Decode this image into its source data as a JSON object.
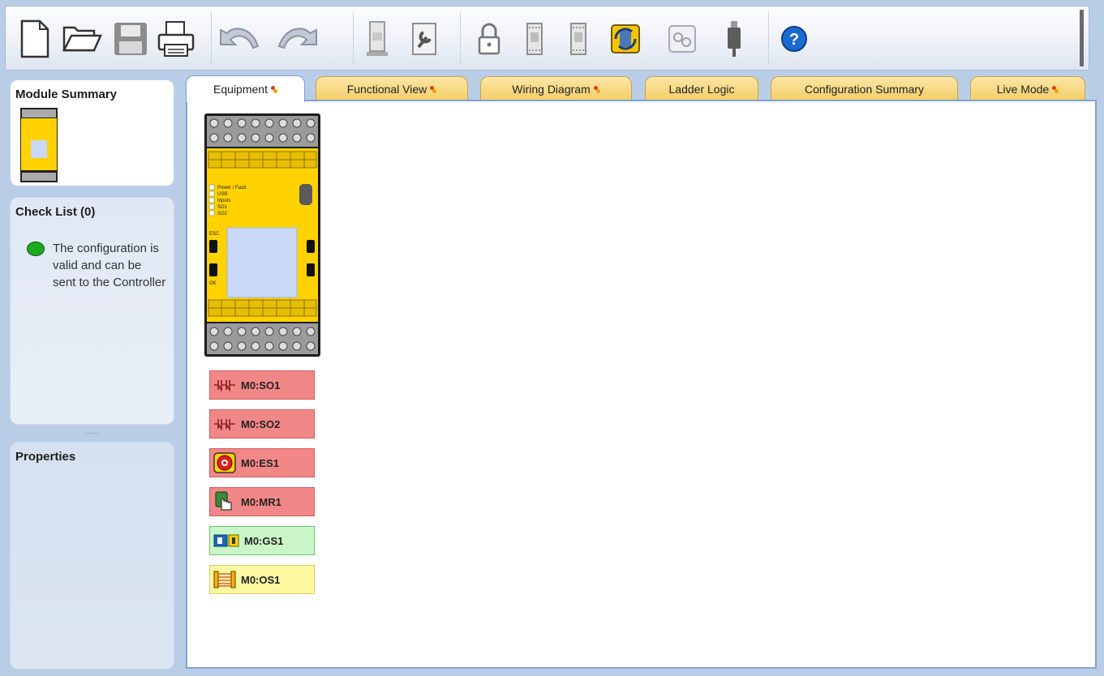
{
  "toolbar": {
    "buttons": [
      {
        "name": "new-file-icon"
      },
      {
        "name": "open-folder-icon"
      },
      {
        "name": "save-icon"
      },
      {
        "name": "print-icon"
      },
      {
        "name": "undo-icon"
      },
      {
        "name": "redo-icon"
      },
      {
        "name": "controller-icon"
      },
      {
        "name": "settings-document-icon"
      },
      {
        "name": "lock-icon"
      },
      {
        "name": "module-icon"
      },
      {
        "name": "module-download-icon"
      },
      {
        "name": "sync-icon"
      },
      {
        "name": "network-icon"
      },
      {
        "name": "usb-plug-icon"
      },
      {
        "name": "help-icon"
      }
    ],
    "help_symbol": "?"
  },
  "sidebar": {
    "module_summary_title": "Module Summary",
    "check_list_title": "Check List (0)",
    "check_message": "The configuration is valid and can be sent to the Controller",
    "properties_title": "Properties",
    "splitter": "....."
  },
  "tabs": [
    {
      "label": "Equipment",
      "flag": true,
      "active": true
    },
    {
      "label": "Functional View",
      "flag": true
    },
    {
      "label": "Wiring Diagram",
      "flag": true
    },
    {
      "label": "Ladder Logic",
      "flag": false
    },
    {
      "label": "Configuration Summary",
      "flag": false
    },
    {
      "label": "Live Mode",
      "flag": true
    }
  ],
  "device": {
    "led_labels": [
      "Power / Fault",
      "USB",
      "Inputs",
      "SO1",
      "SO2"
    ],
    "button_labels": [
      "ESC",
      "OK"
    ]
  },
  "equipment": [
    {
      "label": "M0:SO1",
      "status": "red",
      "icon": "output-contact-icon"
    },
    {
      "label": "M0:SO2",
      "status": "red",
      "icon": "output-contact-icon"
    },
    {
      "label": "M0:ES1",
      "status": "red",
      "icon": "emergency-stop-icon"
    },
    {
      "label": "M0:MR1",
      "status": "red",
      "icon": "manual-reset-icon"
    },
    {
      "label": "M0:GS1",
      "status": "green",
      "icon": "gate-switch-icon"
    },
    {
      "label": "M0:OS1",
      "status": "yellow",
      "icon": "optical-sensor-icon"
    }
  ],
  "colors": {
    "fault_red": "#f28787",
    "ok_green": "#c9f5c9",
    "warn_yellow": "#fbf8a0",
    "tab_gold": "#f3cd66",
    "accent_blue": "#7fa2d8",
    "device_yellow": "#ffd200"
  }
}
